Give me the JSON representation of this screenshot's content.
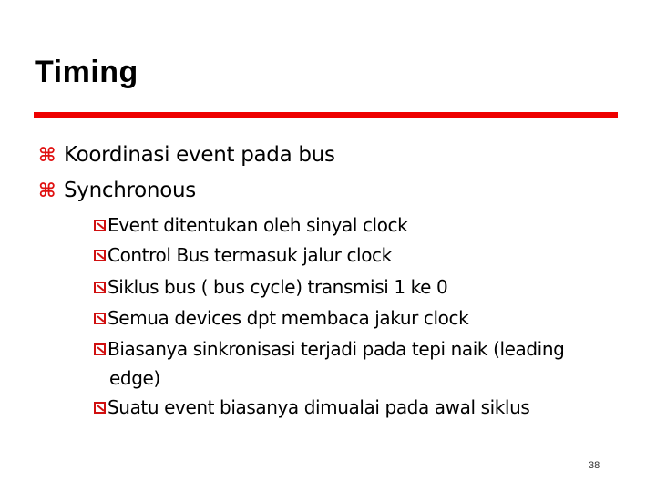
{
  "slide": {
    "title": "Timing",
    "accent_color": "#ee0000",
    "bullets": [
      {
        "icon": "command-bullet-icon",
        "text": "Koordinasi  event pada bus"
      },
      {
        "icon": "command-bullet-icon",
        "text": "Synchronous"
      }
    ],
    "sub_bullets": [
      {
        "icon": "checkbox-bullet-icon",
        "text": "Event ditentukan oleh  sinyal clock"
      },
      {
        "icon": "checkbox-bullet-icon",
        "text": "Control Bus termasuk jalur clock"
      },
      {
        "icon": "checkbox-bullet-icon",
        "text": "Siklus bus ( bus cycle) transmisi 1 ke 0"
      },
      {
        "icon": "checkbox-bullet-icon",
        "text": "Semua devices dpt membaca jakur clock"
      },
      {
        "icon": "checkbox-bullet-icon",
        "text": "Biasanya sinkronisasi terjadi pada tepi naik (leading",
        "continuation": "edge)"
      },
      {
        "icon": "checkbox-bullet-icon",
        "text": "Suatu event biasanya dimualai pada awal siklus"
      }
    ],
    "bullet_glyph": "⌘",
    "page_number": "38"
  }
}
